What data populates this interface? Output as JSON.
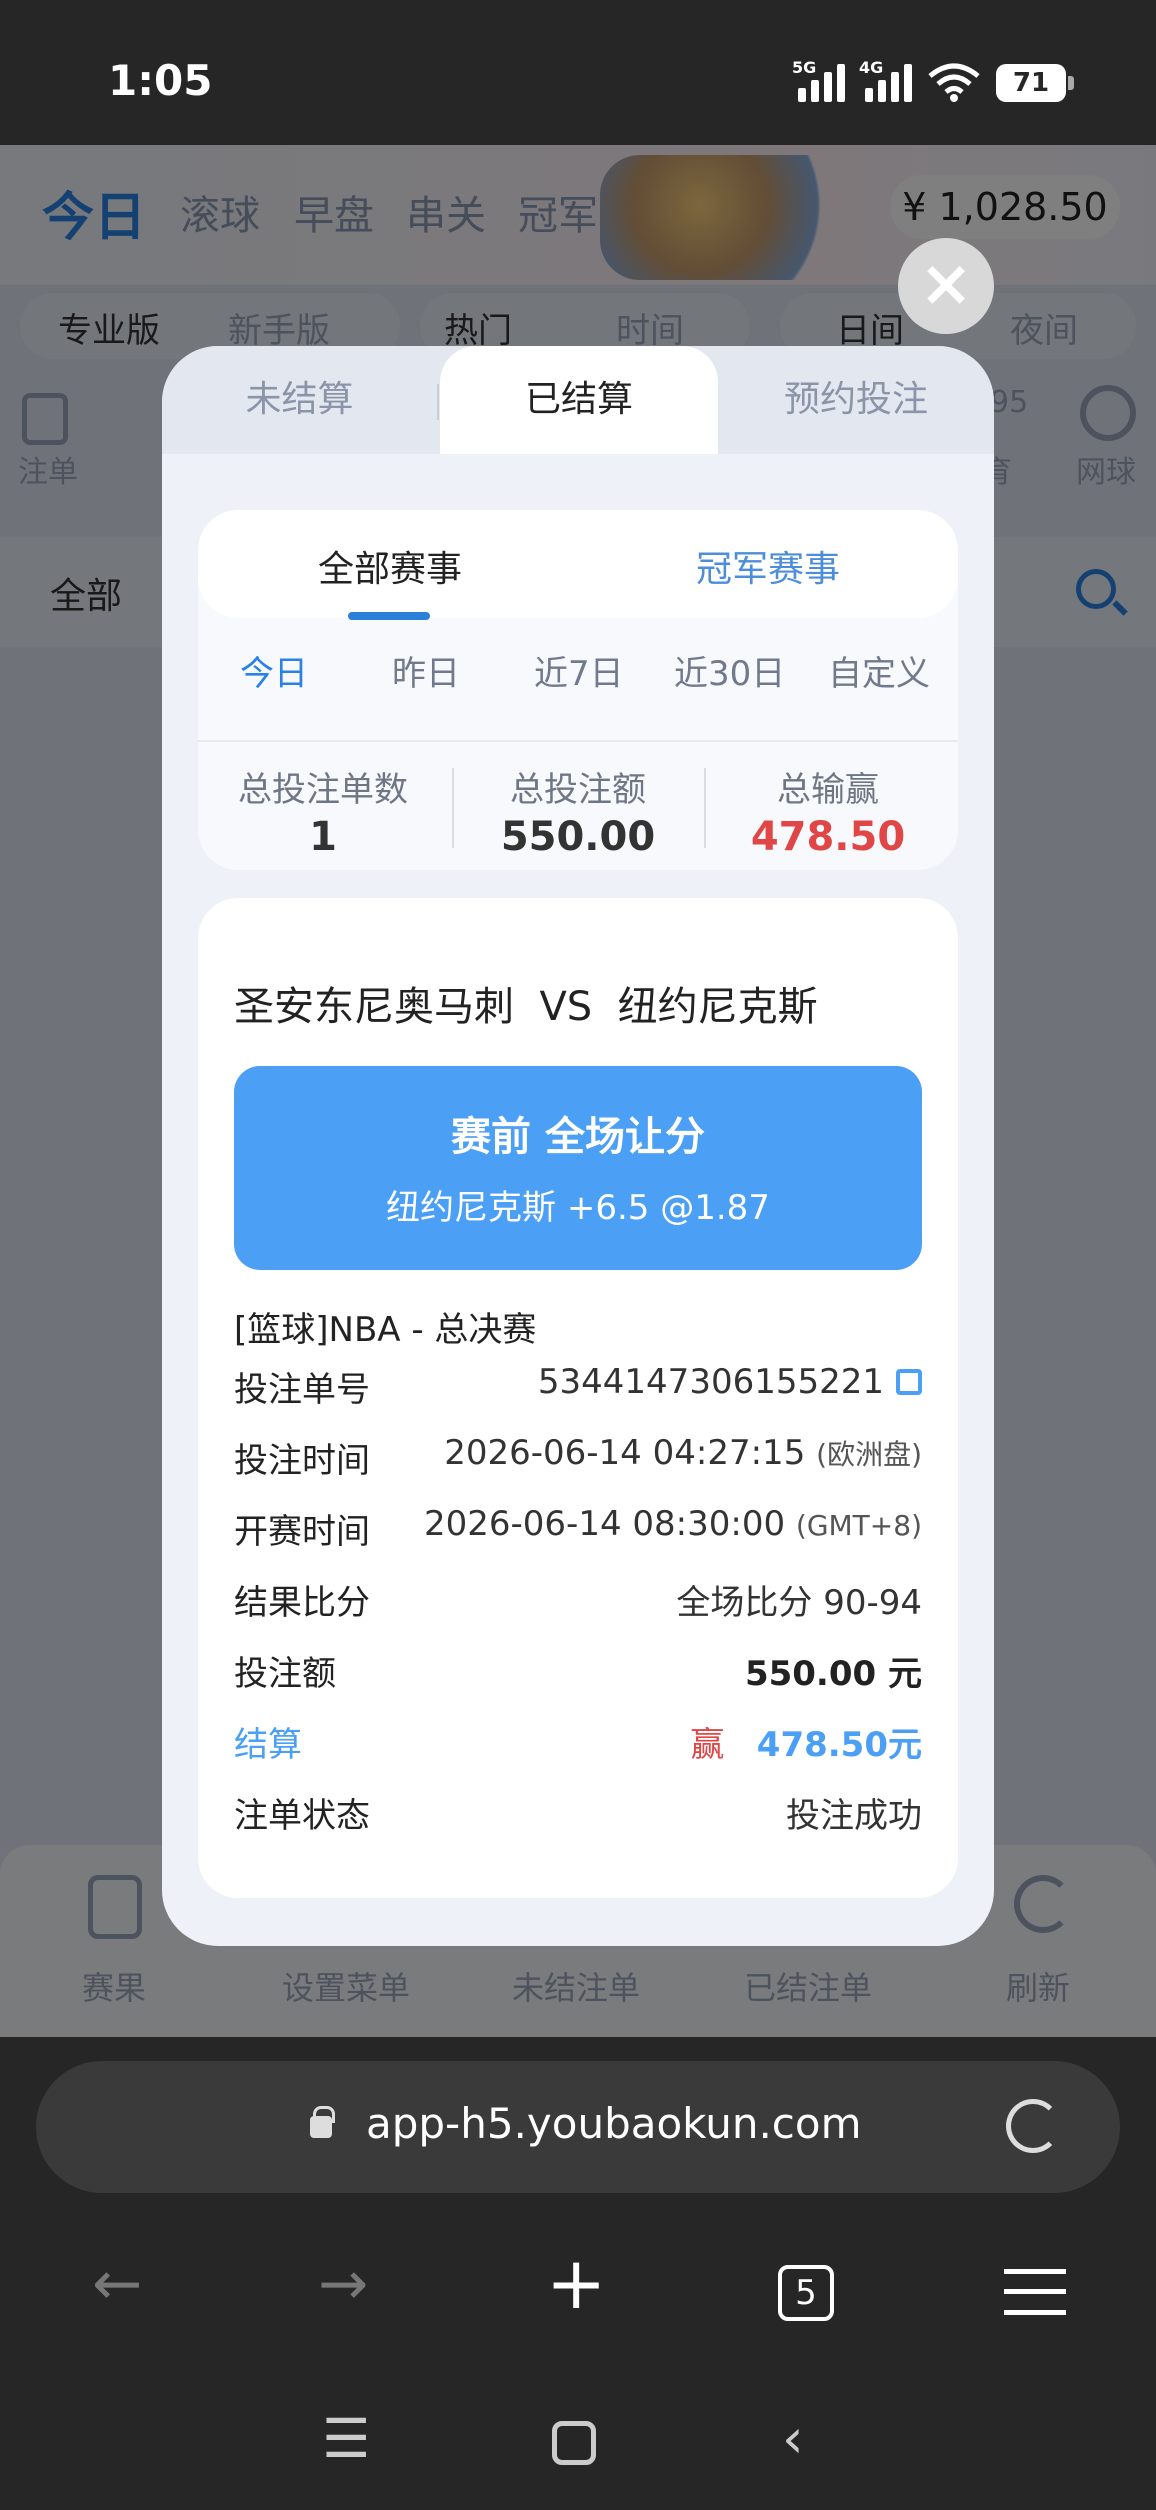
{
  "status_bar": {
    "time": "1:05",
    "net1": "5G",
    "net2": "4G",
    "battery": "71"
  },
  "app": {
    "nav_tabs": [
      "今日",
      "滚球",
      "早盘",
      "串关",
      "冠军"
    ],
    "balance": "¥ 1,028.50",
    "sub_nav": [
      "专业版",
      "新手版",
      "热门",
      "时间",
      "日间",
      "夜间"
    ],
    "left_icon_label": "注单",
    "right_partial": "95",
    "right_partial_label": "育",
    "tennis_label": "网球",
    "all_label": "全部",
    "bottom_bar": [
      "赛果",
      "设置菜单",
      "未结注单",
      "已结注单",
      "刷新"
    ]
  },
  "modal": {
    "tabs": [
      "未结算",
      "已结算",
      "预约投注"
    ],
    "active_tab": "已结算",
    "category_tabs": [
      "全部赛事",
      "冠军赛事"
    ],
    "ranges": [
      "今日",
      "昨日",
      "近7日",
      "近30日",
      "自定义"
    ],
    "stats": {
      "count_label": "总投注单数",
      "count": "1",
      "amount_label": "总投注额",
      "amount": "550.00",
      "winloss_label": "总输赢",
      "winloss": "478.50"
    },
    "bet": {
      "home": "圣安东尼奥马刺",
      "vs": "VS",
      "away": "纽约尼克斯",
      "market": "赛前 全场让分",
      "selection": "纽约尼克斯 +6.5   @1.87",
      "league": "[篮球]NBA - 总决赛",
      "rows": {
        "order_no_label": "投注单号",
        "order_no": "5344147306155221",
        "bet_time_label": "投注时间",
        "bet_time": "2026-06-14 04:27:15",
        "bet_time_note": "(欧洲盘)",
        "start_time_label": "开赛时间",
        "start_time": "2026-06-14 08:30:00",
        "start_time_note": "(GMT+8)",
        "result_label": "结果比分",
        "result": "全场比分 90-94",
        "stake_label": "投注额",
        "stake": "550.00 元",
        "settle_label": "结算",
        "settle_tag": "赢",
        "settle_amount": "478.50元",
        "status_label": "注单状态",
        "status": "投注成功"
      }
    }
  },
  "browser": {
    "url": "app-h5.youbaokun.com",
    "tab_count": "5"
  },
  "colors": {
    "accent": "#4b9ff5",
    "win": "#e04646",
    "active_range": "#2a82e4"
  }
}
